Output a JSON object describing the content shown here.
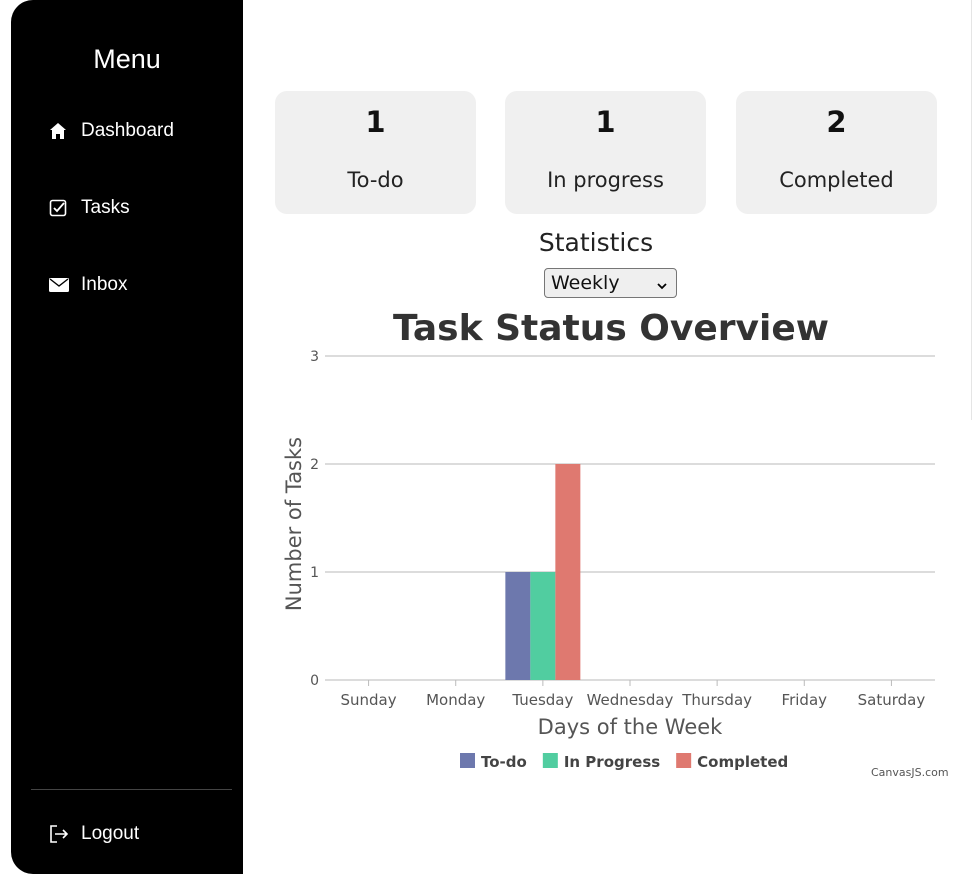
{
  "sidebar": {
    "title": "Menu",
    "items": [
      {
        "label": "Dashboard",
        "icon": "home-icon"
      },
      {
        "label": "Tasks",
        "icon": "task-check-icon"
      },
      {
        "label": "Inbox",
        "icon": "envelope-icon"
      }
    ],
    "logout_label": "Logout"
  },
  "stats": [
    {
      "value": "1",
      "label": "To-do"
    },
    {
      "value": "1",
      "label": "In progress"
    },
    {
      "value": "2",
      "label": "Completed"
    }
  ],
  "statistics": {
    "heading": "Statistics",
    "selected_period": "Weekly"
  },
  "chart_data": {
    "type": "bar",
    "title": "Task Status Overview",
    "xlabel": "Days of the Week",
    "ylabel": "Number of Tasks",
    "categories": [
      "Sunday",
      "Monday",
      "Tuesday",
      "Wednesday",
      "Thursday",
      "Friday",
      "Saturday"
    ],
    "series": [
      {
        "name": "To-do",
        "color": "#6d78ad",
        "values": [
          0,
          0,
          1,
          0,
          0,
          0,
          0
        ]
      },
      {
        "name": "In Progress",
        "color": "#51cda0",
        "values": [
          0,
          0,
          1,
          0,
          0,
          0,
          0
        ]
      },
      {
        "name": "Completed",
        "color": "#df7970",
        "values": [
          0,
          0,
          2,
          0,
          0,
          0,
          0
        ]
      }
    ],
    "ylim": [
      0,
      3
    ],
    "yticks": [
      0,
      1,
      2,
      3
    ],
    "grid": true,
    "legend": "bottom"
  },
  "credit": "CanvasJS.com"
}
